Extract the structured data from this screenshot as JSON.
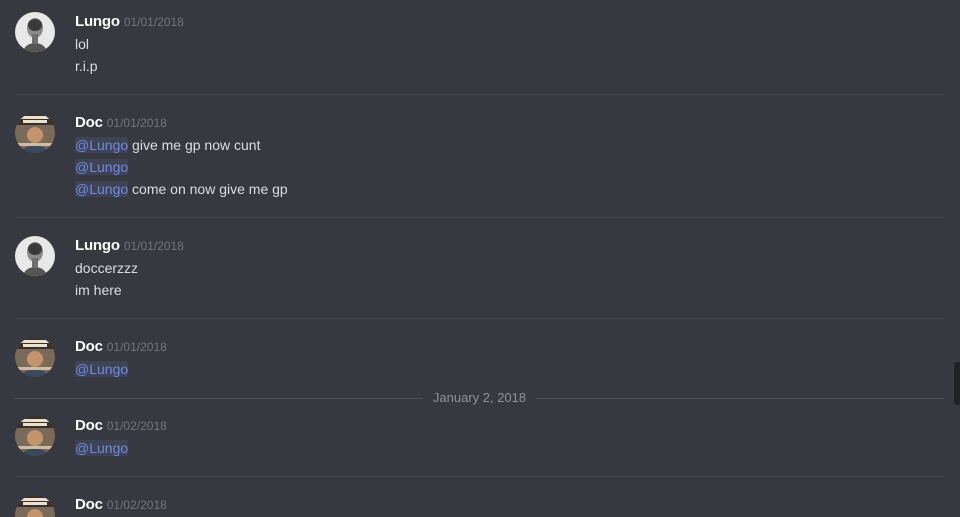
{
  "users": {
    "lungo": {
      "name": "Lungo",
      "avatar_icon": "lungo-avatar-icon"
    },
    "doc": {
      "name": "Doc",
      "avatar_icon": "doc-avatar-icon"
    }
  },
  "messages": [
    {
      "author": "Lungo",
      "timestamp": "01/01/2018",
      "lines": [
        "lol",
        "r.i.p"
      ]
    },
    {
      "author": "Doc",
      "timestamp": "01/01/2018",
      "lines": [
        {
          "mention": "@Lungo",
          "text": " give me gp now cunt"
        },
        {
          "mention": "@Lungo",
          "text": ""
        },
        {
          "mention": "@Lungo",
          "text": " come on now give me gp"
        }
      ]
    },
    {
      "author": "Lungo",
      "timestamp": "01/01/2018",
      "lines": [
        "doccerzzz",
        "im here"
      ]
    },
    {
      "author": "Doc",
      "timestamp": "01/01/2018",
      "lines": [
        {
          "mention": "@Lungo",
          "text": ""
        }
      ]
    },
    {
      "author": "Doc",
      "timestamp": "01/02/2018",
      "lines": [
        {
          "mention": "@Lungo",
          "text": ""
        }
      ]
    },
    {
      "author": "Doc",
      "timestamp": "01/02/2018",
      "lines": []
    }
  ],
  "date_separator": "January 2, 2018",
  "colors": {
    "background": "#36393f",
    "mention": "#7289da",
    "text": "#dcddde",
    "timestamp": "#72767d",
    "username": "#ffffff"
  }
}
